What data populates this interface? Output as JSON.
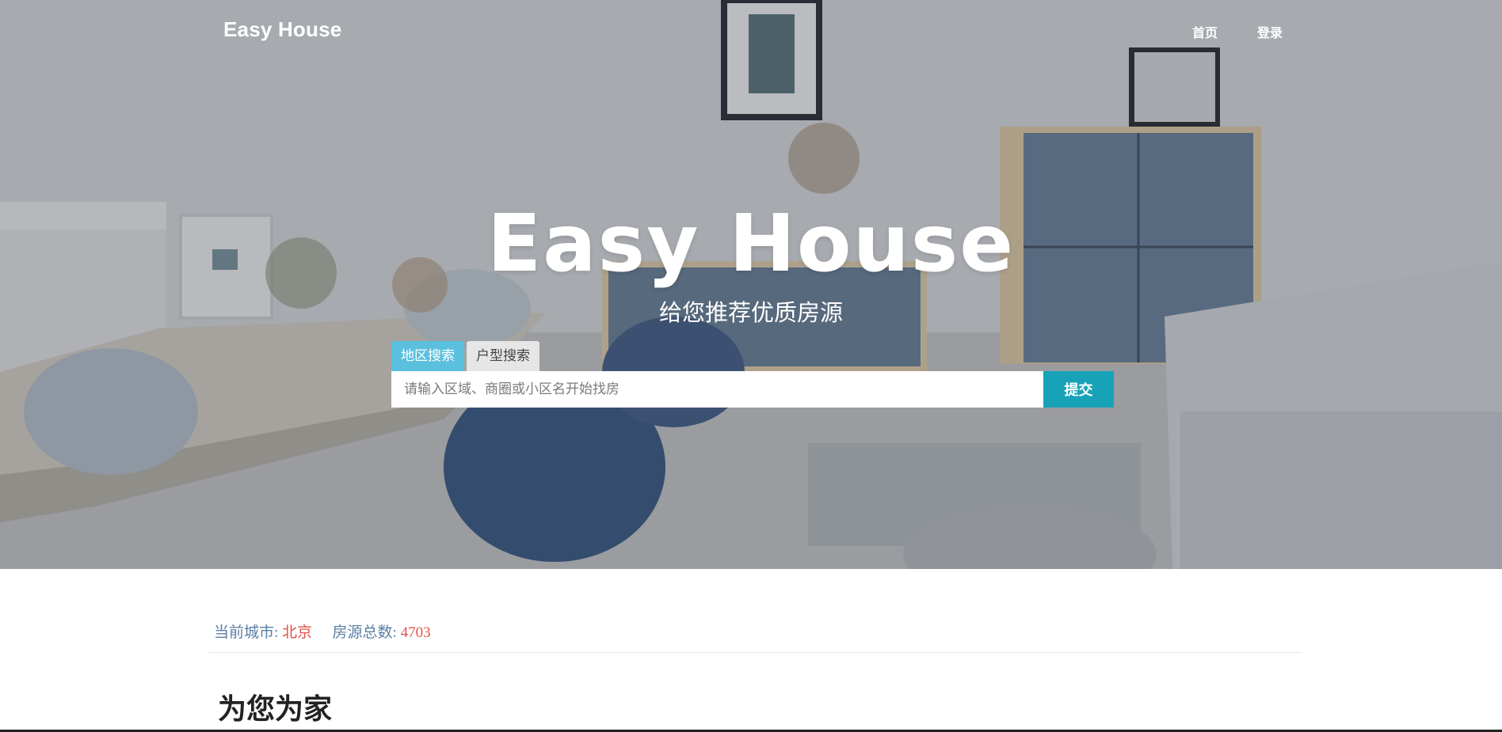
{
  "navbar": {
    "brand": "Easy House",
    "links": [
      {
        "label": "首页"
      },
      {
        "label": "登录"
      }
    ]
  },
  "hero": {
    "title": "Easy House",
    "subtitle": "给您推荐优质房源",
    "background_image": "living-room-photo"
  },
  "search": {
    "tabs": [
      {
        "label": "地区搜索",
        "active": true
      },
      {
        "label": "户型搜索",
        "active": false
      }
    ],
    "placeholder": "请输入区域、商圈或小区名开始找房",
    "value": "",
    "submit_label": "提交"
  },
  "info": {
    "city_label": "当前城市:",
    "city_value": "北京",
    "total_label": "房源总数:",
    "total_value": "4703"
  },
  "section": {
    "title": "为您为家"
  },
  "colors": {
    "accent": "#5bc0de",
    "submit": "#17a2b8",
    "highlight": "#e0524a",
    "info_text": "#5a7fa5"
  }
}
